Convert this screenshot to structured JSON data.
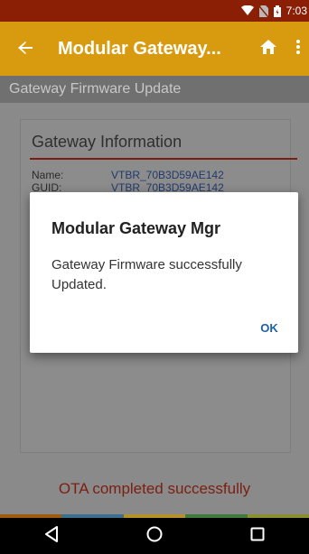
{
  "status_bar": {
    "time": "7:03"
  },
  "app_bar": {
    "title": "Modular Gateway...",
    "back_icon": "arrow-left-icon",
    "home_icon": "home-icon",
    "more_icon": "more-vert-icon"
  },
  "sub_header": {
    "title": "Gateway Firmware Update"
  },
  "info_card": {
    "title": "Gateway Information",
    "rows": [
      {
        "key": "Name:",
        "value": "VTBR_70B3D59AE142"
      },
      {
        "key": "GUID:",
        "value": "VTBR_70B3D59AE142"
      }
    ]
  },
  "ota_status": "OTA completed successfully",
  "dialog": {
    "title": "Modular Gateway Mgr",
    "message": "Gateway Firmware successfully Updated.",
    "ok_label": "OK"
  },
  "colors": {
    "status_bar": "#8a1f06",
    "app_bar": "#d89b10",
    "accent_text": "#7a1f10",
    "dialog_button": "#1e5fa8",
    "strip": [
      "#a05a10",
      "#3b6e8f",
      "#b6902a",
      "#3f7a3f",
      "#8a8f30"
    ]
  }
}
